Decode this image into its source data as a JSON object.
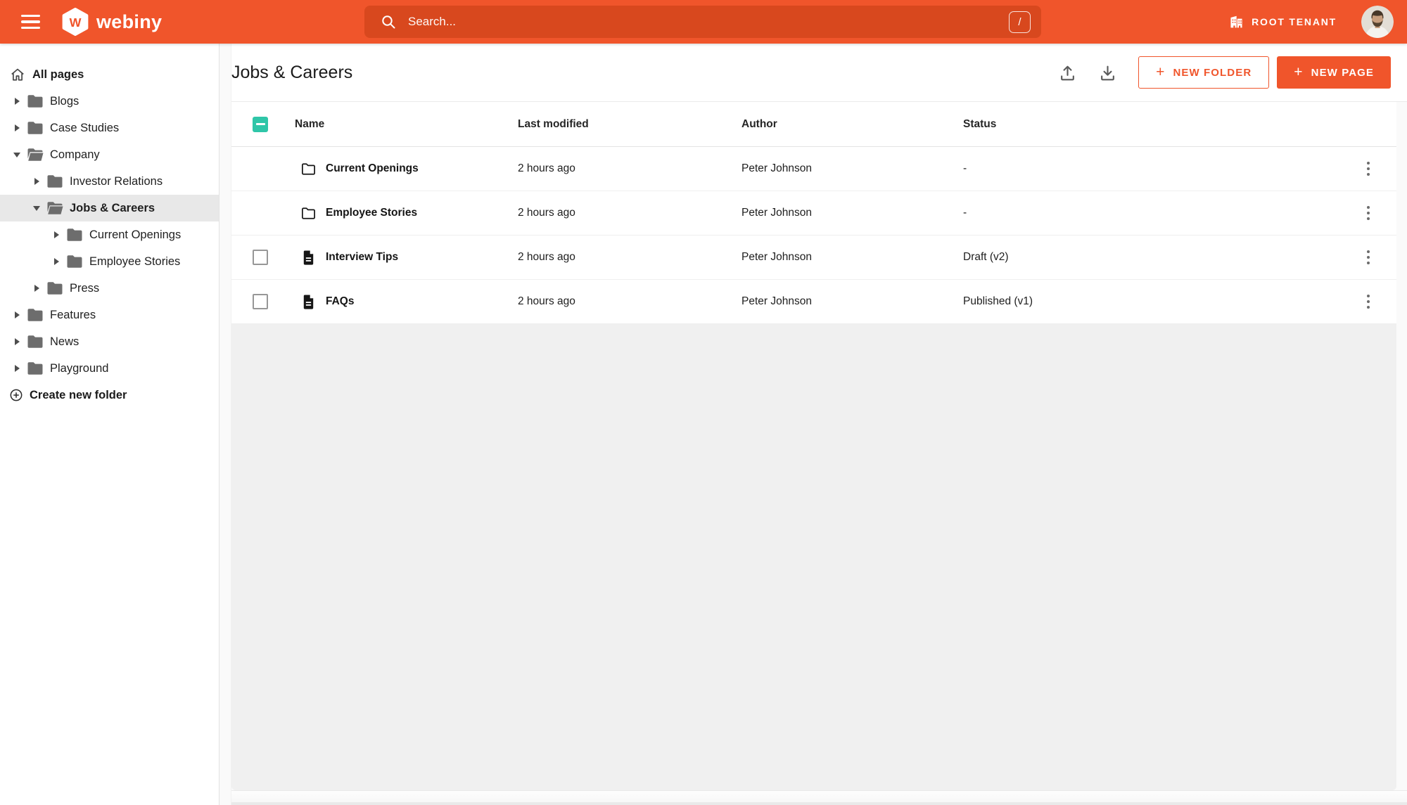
{
  "colors": {
    "accent": "#f0552b",
    "accent_dark": "#d8481e",
    "checkbox_teal": "#2fc6a8",
    "selected_bg": "#e8e8e8"
  },
  "topbar": {
    "logo_text": "webiny",
    "search": {
      "placeholder": "Search...",
      "shortcut": "/"
    },
    "tenant_label": "ROOT TENANT"
  },
  "sidebar": {
    "root_label": "All pages",
    "create_folder_label": "Create new folder",
    "items": [
      {
        "label": "Blogs",
        "level": 1,
        "state": "collapsed",
        "selected": false
      },
      {
        "label": "Case Studies",
        "level": 1,
        "state": "collapsed",
        "selected": false
      },
      {
        "label": "Company",
        "level": 1,
        "state": "expanded",
        "selected": false
      },
      {
        "label": "Investor Relations",
        "level": 2,
        "state": "collapsed",
        "selected": false
      },
      {
        "label": "Jobs & Careers",
        "level": 2,
        "state": "expanded",
        "selected": true
      },
      {
        "label": "Current Openings",
        "level": 3,
        "state": "collapsed",
        "selected": false
      },
      {
        "label": "Employee Stories",
        "level": 3,
        "state": "collapsed",
        "selected": false
      },
      {
        "label": "Press",
        "level": 2,
        "state": "collapsed",
        "selected": false
      },
      {
        "label": "Features",
        "level": 1,
        "state": "collapsed",
        "selected": false
      },
      {
        "label": "News",
        "level": 1,
        "state": "collapsed",
        "selected": false
      },
      {
        "label": "Playground",
        "level": 1,
        "state": "collapsed",
        "selected": false
      }
    ]
  },
  "main": {
    "title": "Jobs & Careers",
    "buttons": {
      "plus_glyph": "+",
      "new_folder": "NEW FOLDER",
      "new_page": "NEW PAGE"
    },
    "table": {
      "columns": [
        "Name",
        "Last modified",
        "Author",
        "Status"
      ],
      "rows": [
        {
          "type": "folder",
          "checkbox": false,
          "name": "Current Openings",
          "modified": "2 hours ago",
          "author": "Peter Johnson",
          "status": "-"
        },
        {
          "type": "folder",
          "checkbox": false,
          "name": "Employee Stories",
          "modified": "2 hours ago",
          "author": "Peter Johnson",
          "status": "-"
        },
        {
          "type": "page",
          "checkbox": true,
          "name": "Interview Tips",
          "modified": "2 hours ago",
          "author": "Peter Johnson",
          "status": "Draft (v2)"
        },
        {
          "type": "page",
          "checkbox": true,
          "name": "FAQs",
          "modified": "2 hours ago",
          "author": "Peter Johnson",
          "status": "Published (v1)"
        }
      ]
    }
  }
}
